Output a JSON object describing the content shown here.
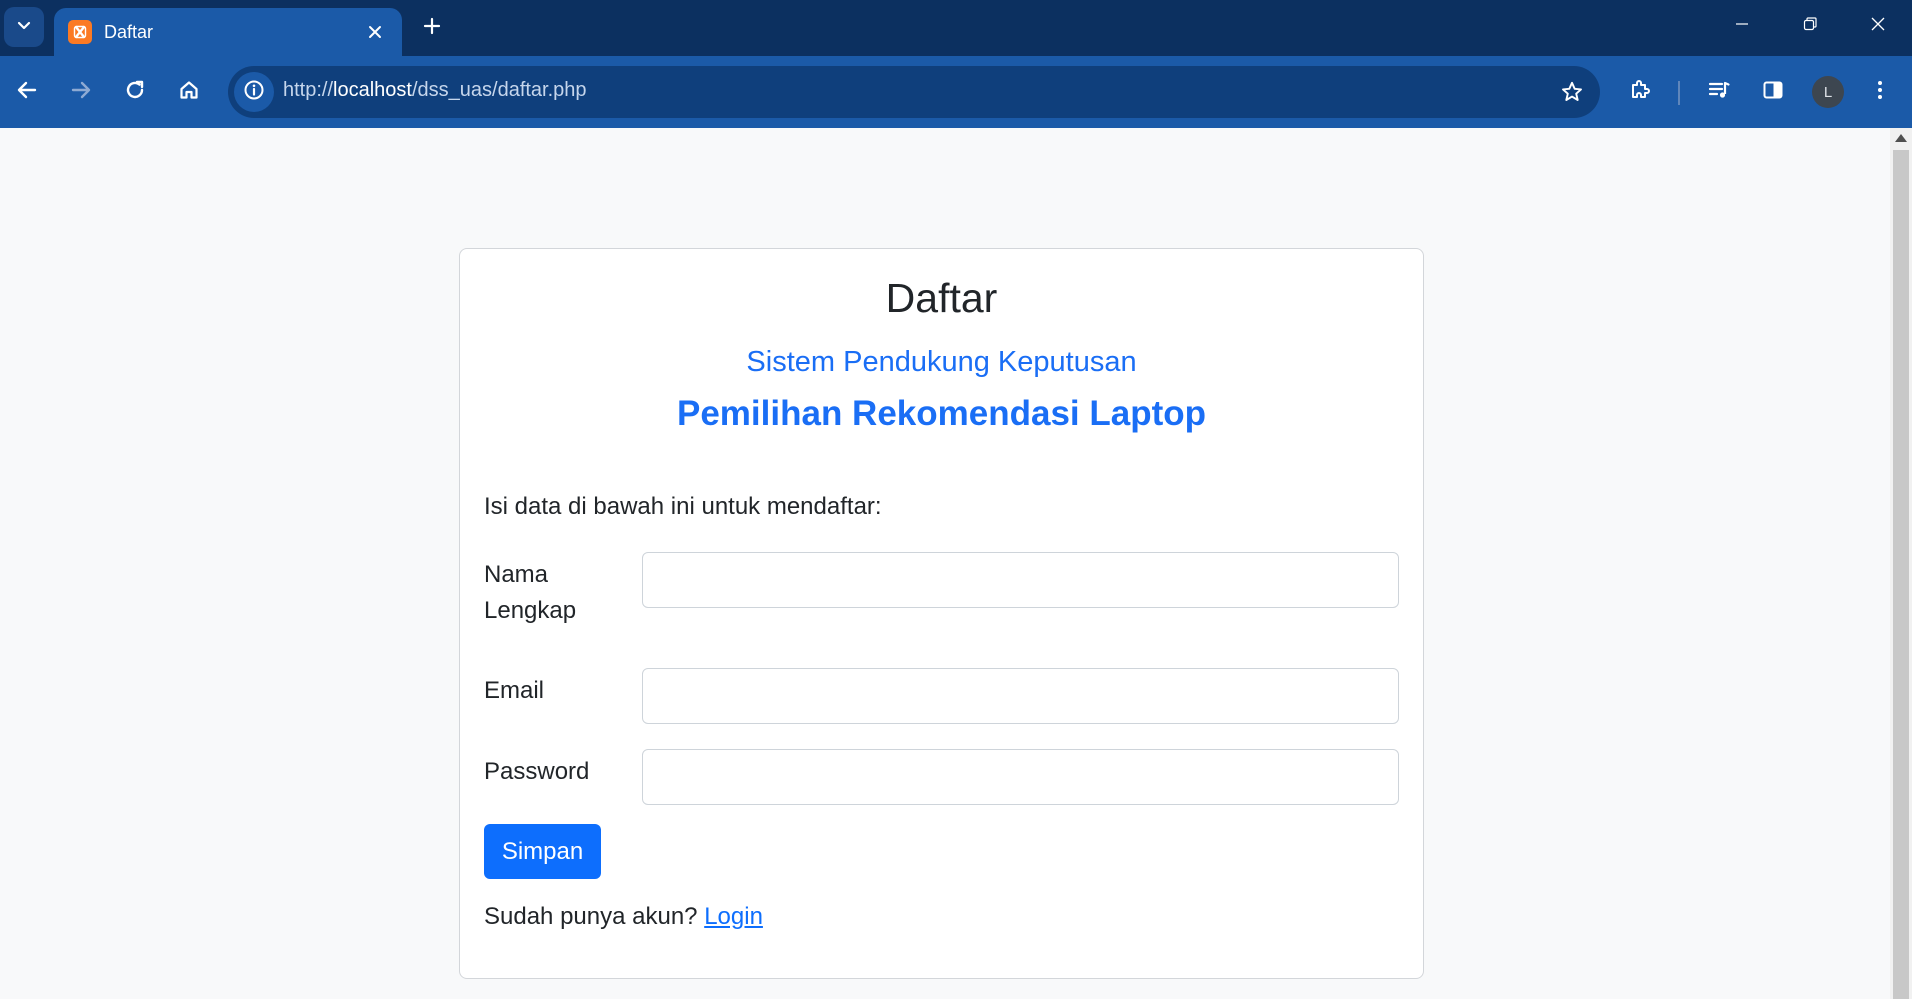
{
  "browser": {
    "tab_title": "Daftar",
    "url_prefix": "http://",
    "url_host": "localhost",
    "url_path": "/dss_uas/daftar.php",
    "profile_initial": "L",
    "colors": {
      "titlebar": "#0c3060",
      "toolbar": "#1b5aa8",
      "favicon": "#fb7a24"
    }
  },
  "page": {
    "title": "Daftar",
    "subtitle": "Sistem Pendukung Keputusan",
    "headline": "Pemilihan Rekomendasi Laptop",
    "intro": "Isi data di bawah ini untuk mendaftar:",
    "fields": {
      "name_label": "Nama Lengkap",
      "name_value": "",
      "email_label": "Email",
      "email_value": "",
      "password_label": "Password",
      "password_value": ""
    },
    "submit_label": "Simpan",
    "footer_text": "Sudah punya akun?",
    "login_link": "Login",
    "colors": {
      "accent": "#0d6efd",
      "heading": "#1a6ef5"
    }
  }
}
